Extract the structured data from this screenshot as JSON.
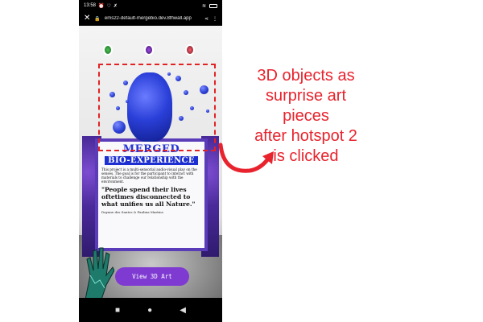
{
  "status_bar": {
    "time": "13:58",
    "icons": [
      "alarm-icon",
      "heart-icon",
      "mute-icon"
    ],
    "right_icons": [
      "wifi-icon",
      "battery-icon"
    ]
  },
  "browser": {
    "url": "ems22-default-mergebio.dev.8thwall.app",
    "close_icon": "close-icon",
    "share_icon": "share-icon",
    "menu_icon": "more-vert-icon"
  },
  "hotspots": [
    {
      "name": "hotspot-1",
      "color": "#49c14f"
    },
    {
      "name": "hotspot-2",
      "color": "#a04ce2"
    },
    {
      "name": "hotspot-3",
      "color": "#ff5a6e"
    }
  ],
  "poster": {
    "title": "MERGED",
    "subtitle": "BIO-EXPERIENCE",
    "body": "This project is a multi-sensorial audio-visual play on the senses. The goal is for the participant to interact with materials to challenge our relationship with the environment.",
    "quote": "\"People spend their lives oftetimes disconnected to what unifies us all Nature.\"",
    "credits": "Dayane dos Santos  &  Paulina Martins"
  },
  "view_button": {
    "label": "View 3D Art"
  },
  "nav": {
    "icons": [
      "recents-square-icon",
      "home-circle-icon",
      "back-triangle-icon"
    ],
    "glyphs": [
      "■",
      "●",
      "◀"
    ]
  },
  "annotation": {
    "line1": "3D objects as",
    "line2": "surprise art pieces",
    "line3": "after hotspot 2",
    "line4": "is clicked",
    "color": "#e8232d"
  }
}
